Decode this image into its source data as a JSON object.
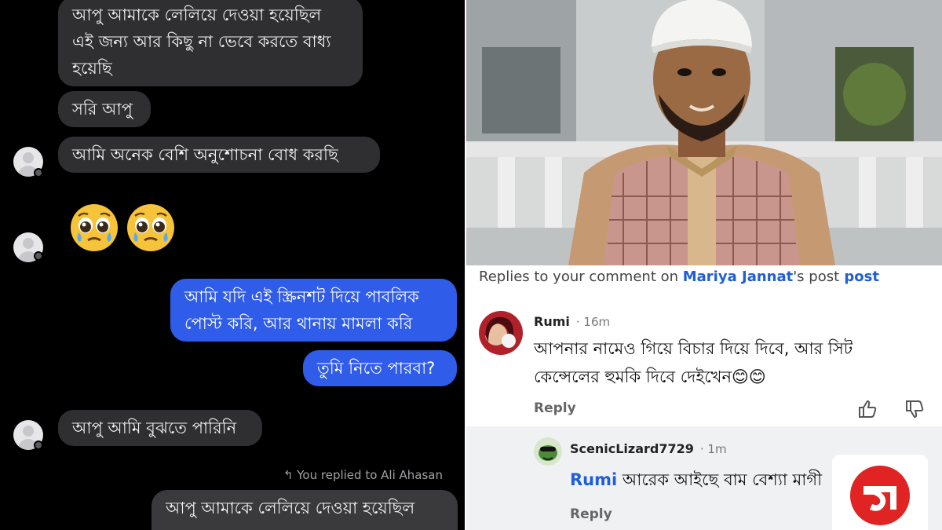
{
  "chat": {
    "messages": [
      {
        "side": "in",
        "text": "আপু আমাকে লেলিয়ে দেওয়া হয়েছিল\nএই জন্য আর কিছু না ভেবে করতে বাধ্য\nহয়েছি"
      },
      {
        "side": "in",
        "text": "সরি আপু"
      },
      {
        "side": "in",
        "text": "আমি অনেক বেশি অনুশোচনা বোধ করছি"
      },
      {
        "side": "in",
        "text": "🥹🥹"
      },
      {
        "side": "out",
        "text": "আমি যদি এই স্ক্রিনশট দিয়ে পাবলিক\nপোস্ট করি, আর থানায় মামলা করি"
      },
      {
        "side": "out",
        "text": "তুমি নিতে পারবা?"
      },
      {
        "side": "in",
        "text": "আপু আমি বুঝতে পারিনি"
      },
      {
        "side": "out",
        "text": "আপু আমাকে লেলিয়ে দেওয়া হয়েছিল"
      }
    ],
    "reply_note": "↰ You replied to Ali Ahasan"
  },
  "facebook": {
    "header_prefix": "Replies to your comment on ",
    "header_name": "Mariya Jannat",
    "header_suffix": "'s post",
    "comment": {
      "author": "Rumi",
      "time": "· 16m",
      "text": "আপনার নামেও গিয়ে বিচার দিয়ে দিবে, আর সিট\nকেন্সেলের হুমকি দিবে দেইখেন😊😊",
      "reply_label": "Reply"
    },
    "reply": {
      "author": "ScenicLizard7729",
      "time": "· 1m",
      "mention": "Rumi",
      "text": " আরেক আইছে বাম বেশ্যা মাগী",
      "reply_label": "Reply"
    }
  },
  "colors": {
    "outgoing_bubble": "#2f5ce8",
    "incoming_bubble": "#2f2f31",
    "link_blue": "#1f5fd6",
    "logo_red": "#e02323"
  },
  "icons": [
    "like-icon",
    "dislike-icon",
    "reply-arrow-icon",
    "pleading-face-emoji",
    "brand-logo"
  ]
}
